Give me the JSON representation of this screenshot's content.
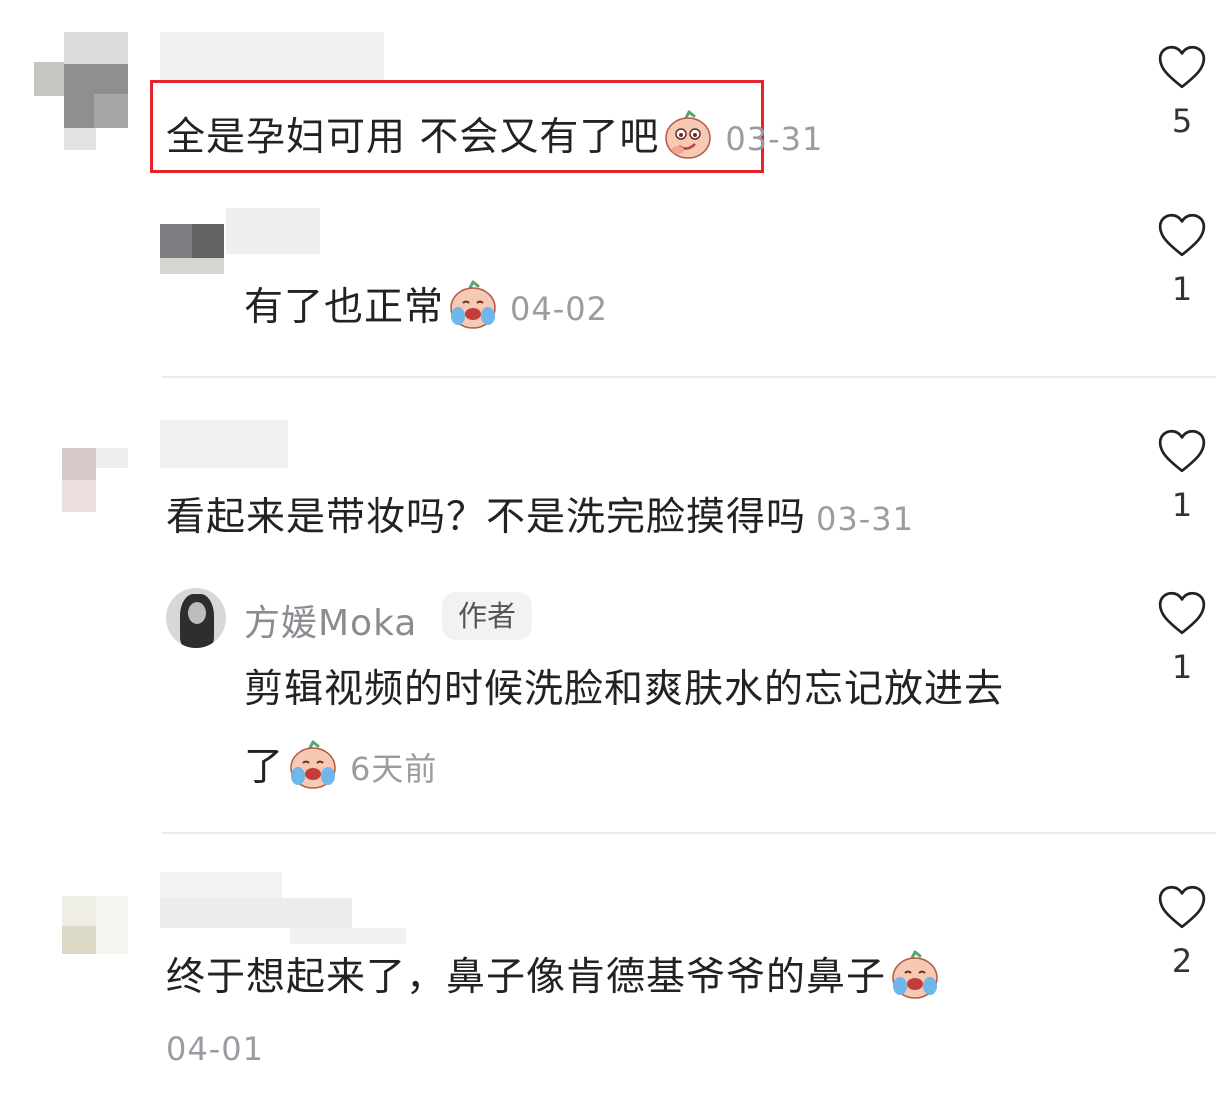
{
  "comments": [
    {
      "text": "全是孕妇可用 不会又有了吧",
      "time": "03-31",
      "likes": "5",
      "emoji": "smirk-face-emoji"
    },
    {
      "text": "有了也正常",
      "time": "04-02",
      "likes": "1",
      "emoji": "crying-laugh-face-emoji"
    },
    {
      "text": "看起来是带妆吗？不是洗完脸摸得吗",
      "time": "03-31",
      "likes": "1"
    },
    {
      "author": "方媛Moka",
      "badge": "作者",
      "text_line1": "剪辑视频的时候洗脸和爽肤水的忘记放进去",
      "text_line2": "了",
      "time": "6天前",
      "likes": "1",
      "emoji": "crying-laugh-face-emoji"
    },
    {
      "text": "终于想起来了，鼻子像肯德基爷爷的鼻子",
      "time": "04-01",
      "likes": "2",
      "emoji": "crying-laugh-face-emoji"
    }
  ],
  "colors": {
    "highlight": "#e3242b",
    "time": "#9b9ba1",
    "divider": "#ececf0"
  }
}
